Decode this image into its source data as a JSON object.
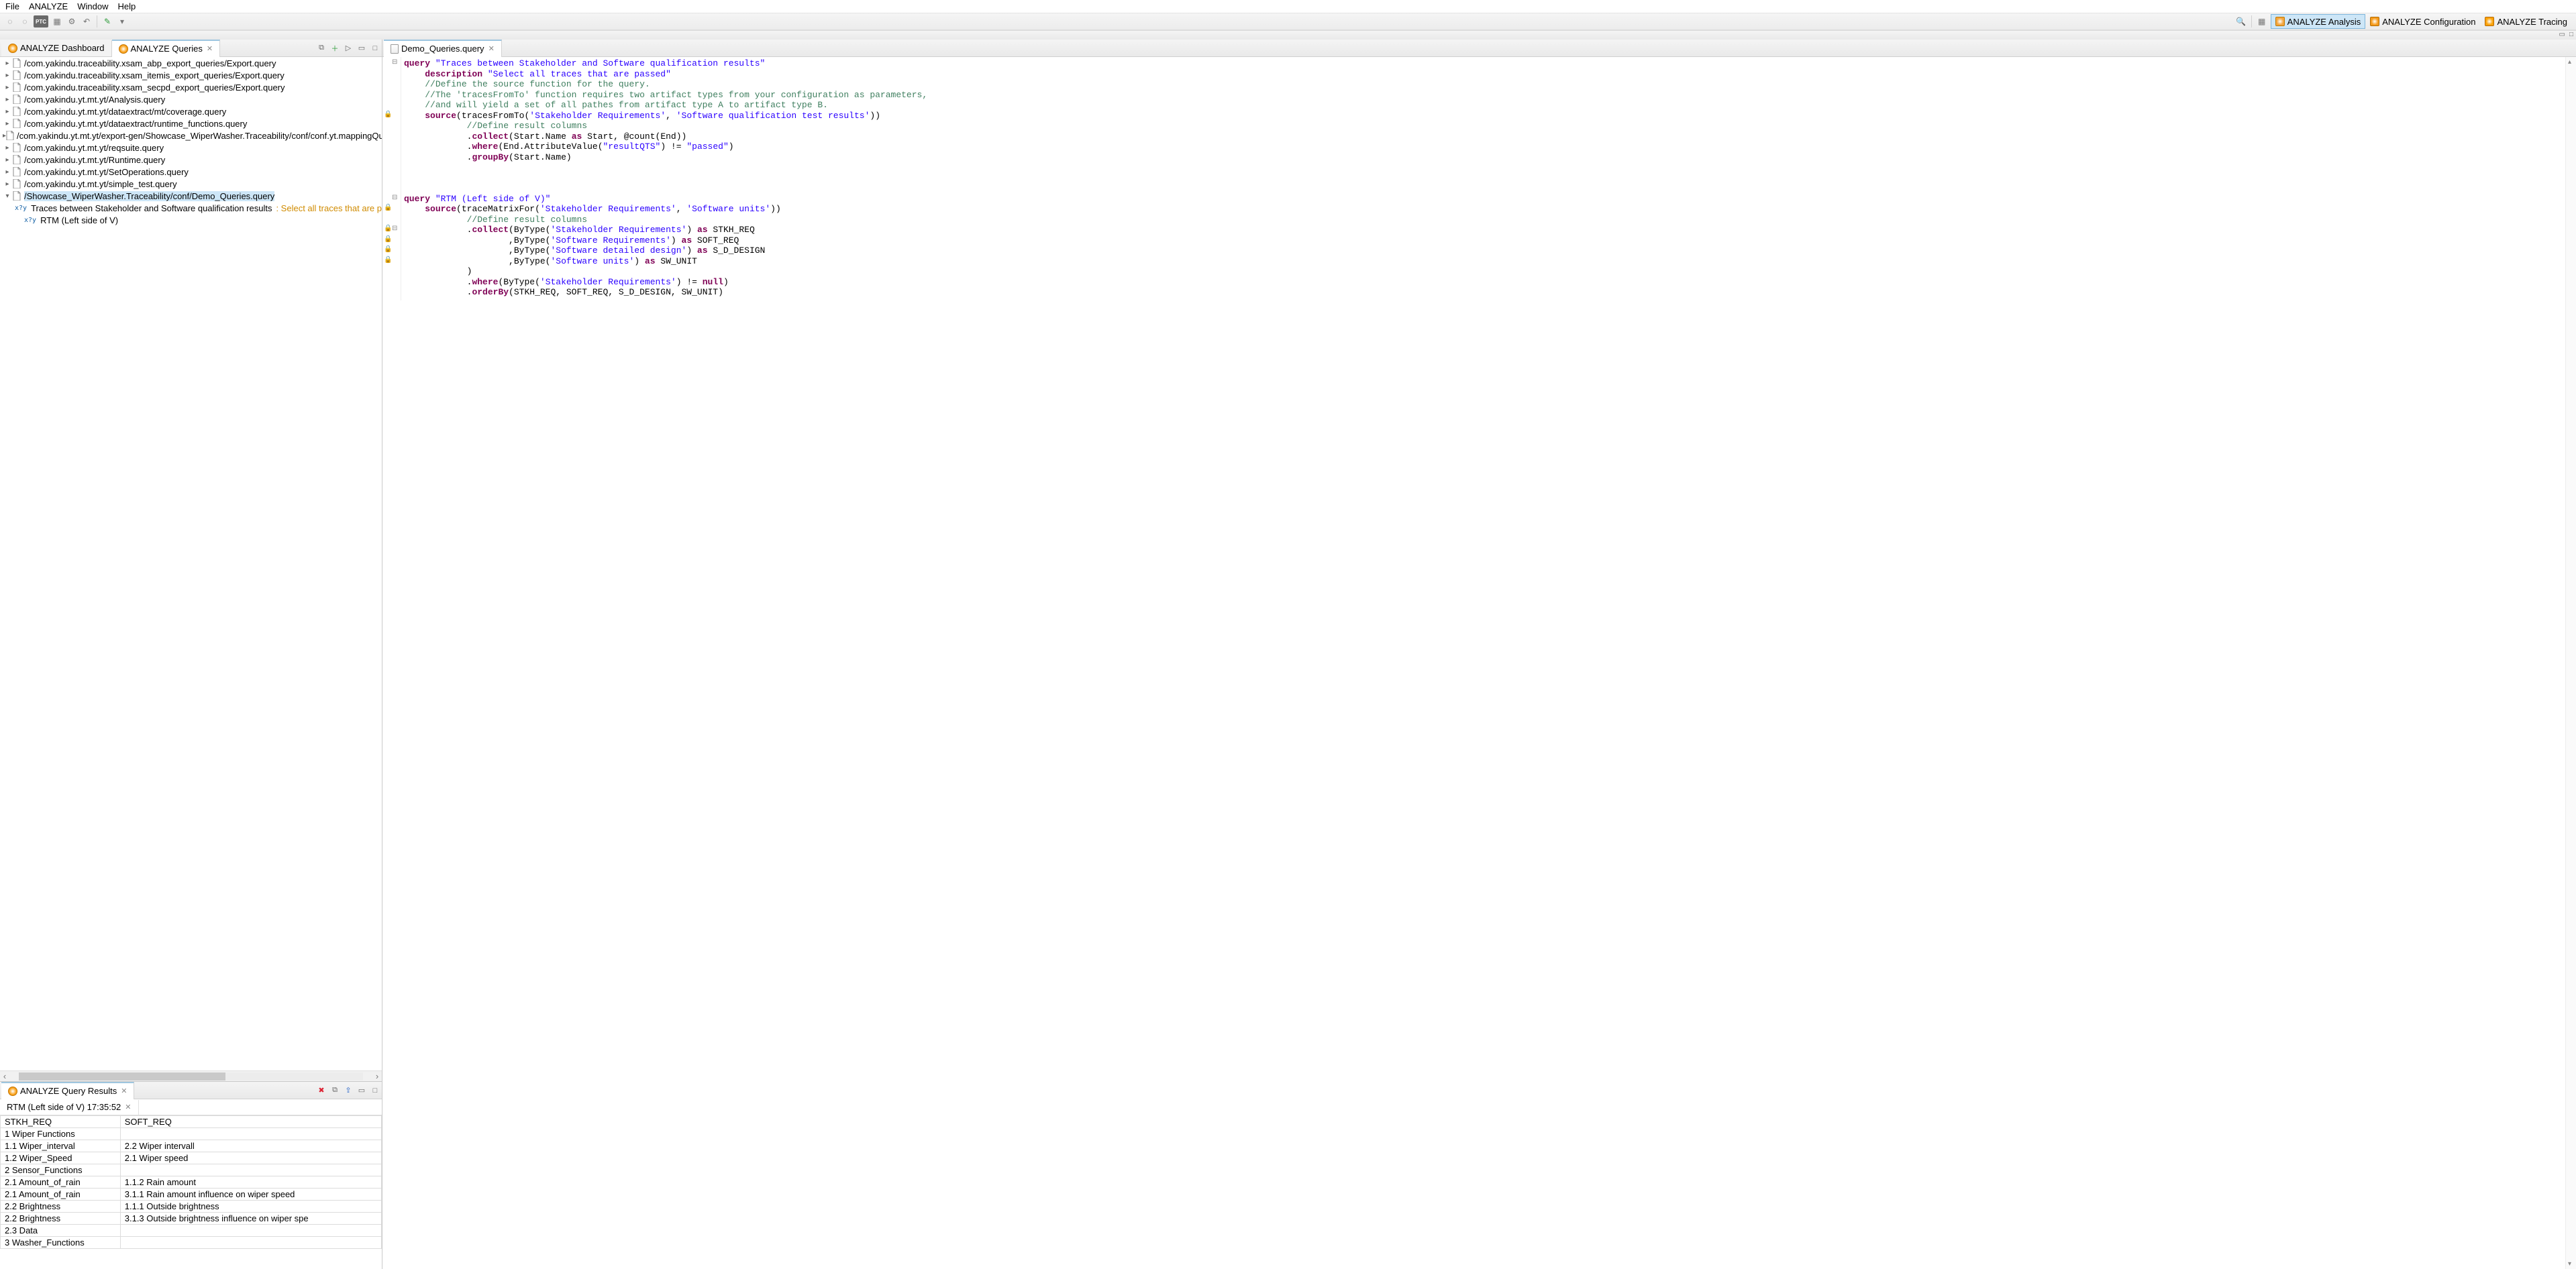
{
  "menu": {
    "items": [
      "File",
      "ANALYZE",
      "Window",
      "Help"
    ]
  },
  "toolbar_left_icons": [
    "nav-back-icon",
    "nav-fwd-icon",
    "ptc-icon",
    "grid-icon",
    "gear-icon",
    "undo-icon",
    "new-doc-icon",
    "dropdown-icon"
  ],
  "search_icon": "search",
  "open_persp_icon": "grid",
  "perspectives": [
    {
      "id": "analysis",
      "label": "ANALYZE Analysis",
      "active": true
    },
    {
      "id": "config",
      "label": "ANALYZE Configuration",
      "active": false
    },
    {
      "id": "tracing",
      "label": "ANALYZE Tracing",
      "active": false
    }
  ],
  "left_tabs": [
    {
      "id": "dashboard",
      "label": "ANALYZE Dashboard",
      "active": false,
      "closable": false
    },
    {
      "id": "queries",
      "label": "ANALYZE Queries",
      "active": true,
      "closable": true
    }
  ],
  "left_tab_toolbar": [
    "add-icon",
    "plus-icon",
    "run-icon",
    "minimize-icon",
    "maximize-icon"
  ],
  "tree": [
    {
      "expandable": true,
      "label": "/com.yakindu.traceability.xsam_abp_export_queries/Export.query"
    },
    {
      "expandable": true,
      "label": "/com.yakindu.traceability.xsam_itemis_export_queries/Export.query"
    },
    {
      "expandable": true,
      "label": "/com.yakindu.traceability.xsam_secpd_export_queries/Export.query"
    },
    {
      "expandable": true,
      "label": "/com.yakindu.yt.mt.yt/Analysis.query"
    },
    {
      "expandable": true,
      "label": "/com.yakindu.yt.mt.yt/dataextract/mt/coverage.query"
    },
    {
      "expandable": true,
      "label": "/com.yakindu.yt.mt.yt/dataextract/runtime_functions.query"
    },
    {
      "expandable": true,
      "label": "/com.yakindu.yt.mt.yt/export-gen/Showcase_WiperWasher.Traceability/conf/conf.yt.mappingQuerie"
    },
    {
      "expandable": true,
      "label": "/com.yakindu.yt.mt.yt/reqsuite.query"
    },
    {
      "expandable": true,
      "label": "/com.yakindu.yt.mt.yt/Runtime.query"
    },
    {
      "expandable": true,
      "label": "/com.yakindu.yt.mt.yt/SetOperations.query"
    },
    {
      "expandable": true,
      "label": "/com.yakindu.yt.mt.yt/simple_test.query"
    },
    {
      "expandable": true,
      "open": true,
      "selected": true,
      "label": "/Showcase_WiperWasher.Traceability/conf/Demo_Queries.query",
      "children": [
        {
          "q": true,
          "label": "Traces between Stakeholder and Software qualification results",
          "suffix": ": Select all traces that are passed"
        },
        {
          "q": true,
          "label": "RTM (Left side of V)"
        }
      ]
    }
  ],
  "results_view": {
    "title": "ANALYZE Query Results",
    "toolbar": [
      "delete-icon",
      "copy-icon",
      "export-icon",
      "minimize-icon",
      "maximize-icon"
    ],
    "inner_tab": "RTM (Left side of V) 17:35:52",
    "columns": [
      "STKH_REQ",
      "SOFT_REQ"
    ],
    "rows": [
      [
        "1 Wiper Functions",
        ""
      ],
      [
        "1.1 Wiper_interval",
        "2.2 Wiper intervall"
      ],
      [
        "1.2 Wiper_Speed",
        "2.1 Wiper speed"
      ],
      [
        "2 Sensor_Functions",
        ""
      ],
      [
        "2.1 Amount_of_rain",
        "1.1.2 Rain amount"
      ],
      [
        "2.1 Amount_of_rain",
        "3.1.1 Rain amount influence on wiper speed"
      ],
      [
        "2.2 Brightness",
        "1.1.1 Outside brightness"
      ],
      [
        "2.2 Brightness",
        "3.1.3 Outside brightness influence on wiper spe"
      ],
      [
        "2.3 Data",
        ""
      ],
      [
        "3 Washer_Functions",
        ""
      ]
    ]
  },
  "editor_tab": "Demo_Queries.query",
  "code_lines": [
    {
      "fold": "-",
      "tokens": [
        {
          "t": "kw",
          "v": "query"
        },
        {
          "t": "sp"
        },
        {
          "t": "str",
          "v": "\"Traces between Stakeholder and Software qualification results\""
        }
      ]
    },
    {
      "tokens": [
        {
          "t": "in",
          "n": 1
        },
        {
          "t": "kw",
          "v": "description"
        },
        {
          "t": "sp"
        },
        {
          "t": "str",
          "v": "\"Select all traces that are passed\""
        }
      ]
    },
    {
      "tokens": [
        {
          "t": "in",
          "n": 1
        },
        {
          "t": "cm",
          "v": "//Define the source function for the query."
        }
      ]
    },
    {
      "tokens": [
        {
          "t": "in",
          "n": 1
        },
        {
          "t": "cm",
          "v": "//The 'tracesFromTo' function requires two artifact types from your configuration as parameters,"
        }
      ]
    },
    {
      "tokens": [
        {
          "t": "in",
          "n": 1
        },
        {
          "t": "cm",
          "v": "//and will yield a set of all pathes from artifact type A to artifact type B."
        }
      ]
    },
    {
      "lock": true,
      "tokens": [
        {
          "t": "in",
          "n": 1
        },
        {
          "t": "kw",
          "v": "source"
        },
        {
          "t": "op",
          "v": "("
        },
        {
          "t": "id",
          "v": "tracesFromTo"
        },
        {
          "t": "op",
          "v": "("
        },
        {
          "t": "str",
          "v": "'Stakeholder Requirements'"
        },
        {
          "t": "op",
          "v": ", "
        },
        {
          "t": "str",
          "v": "'Software qualification test results'"
        },
        {
          "t": "op",
          "v": "))"
        }
      ]
    },
    {
      "tokens": [
        {
          "t": "in",
          "n": 3
        },
        {
          "t": "cm",
          "v": "//Define result columns"
        }
      ]
    },
    {
      "tokens": [
        {
          "t": "in",
          "n": 3
        },
        {
          "t": "op",
          "v": "."
        },
        {
          "t": "kw",
          "v": "collect"
        },
        {
          "t": "op",
          "v": "("
        },
        {
          "t": "id",
          "v": "Start.Name "
        },
        {
          "t": "kw",
          "v": "as"
        },
        {
          "t": "id",
          "v": " Start, @count(End)"
        },
        {
          "t": "op",
          "v": ")"
        }
      ]
    },
    {
      "tokens": [
        {
          "t": "in",
          "n": 3
        },
        {
          "t": "op",
          "v": "."
        },
        {
          "t": "kw",
          "v": "where"
        },
        {
          "t": "op",
          "v": "("
        },
        {
          "t": "id",
          "v": "End.AttributeValue("
        },
        {
          "t": "str",
          "v": "\"resultQTS\""
        },
        {
          "t": "id",
          "v": ") != "
        },
        {
          "t": "str",
          "v": "\"passed\""
        },
        {
          "t": "op",
          "v": ")"
        }
      ]
    },
    {
      "tokens": [
        {
          "t": "in",
          "n": 3
        },
        {
          "t": "op",
          "v": "."
        },
        {
          "t": "kw",
          "v": "groupBy"
        },
        {
          "t": "op",
          "v": "("
        },
        {
          "t": "id",
          "v": "Start.Name"
        },
        {
          "t": "op",
          "v": ")"
        }
      ]
    },
    {
      "blank": true
    },
    {
      "blank": true
    },
    {
      "blank": true
    },
    {
      "fold": "-",
      "tokens": [
        {
          "t": "kw",
          "v": "query"
        },
        {
          "t": "sp"
        },
        {
          "t": "str",
          "v": "\"RTM (Left side of V)\""
        }
      ]
    },
    {
      "lock": true,
      "tokens": [
        {
          "t": "in",
          "n": 1
        },
        {
          "t": "kw",
          "v": "source"
        },
        {
          "t": "op",
          "v": "("
        },
        {
          "t": "id",
          "v": "traceMatrixFor"
        },
        {
          "t": "op",
          "v": "("
        },
        {
          "t": "str",
          "v": "'Stakeholder Requirements'"
        },
        {
          "t": "op",
          "v": ", "
        },
        {
          "t": "str",
          "v": "'Software units'"
        },
        {
          "t": "op",
          "v": "))"
        }
      ]
    },
    {
      "tokens": [
        {
          "t": "in",
          "n": 3
        },
        {
          "t": "cm",
          "v": "//Define result columns"
        }
      ]
    },
    {
      "lock": true,
      "fold": "-",
      "tokens": [
        {
          "t": "in",
          "n": 3
        },
        {
          "t": "op",
          "v": "."
        },
        {
          "t": "kw",
          "v": "collect"
        },
        {
          "t": "op",
          "v": "("
        },
        {
          "t": "id",
          "v": "ByType"
        },
        {
          "t": "op",
          "v": "("
        },
        {
          "t": "str",
          "v": "'Stakeholder Requirements'"
        },
        {
          "t": "op",
          "v": ") "
        },
        {
          "t": "kw",
          "v": "as"
        },
        {
          "t": "id",
          "v": " STKH_REQ"
        }
      ]
    },
    {
      "lock": true,
      "tokens": [
        {
          "t": "in",
          "n": 5
        },
        {
          "t": "op",
          "v": ","
        },
        {
          "t": "id",
          "v": "ByType"
        },
        {
          "t": "op",
          "v": "("
        },
        {
          "t": "str",
          "v": "'Software Requirements'"
        },
        {
          "t": "op",
          "v": ") "
        },
        {
          "t": "kw",
          "v": "as"
        },
        {
          "t": "id",
          "v": " SOFT_REQ"
        }
      ]
    },
    {
      "lock": true,
      "tokens": [
        {
          "t": "in",
          "n": 5
        },
        {
          "t": "op",
          "v": ","
        },
        {
          "t": "id",
          "v": "ByType"
        },
        {
          "t": "op",
          "v": "("
        },
        {
          "t": "str",
          "v": "'Software detailed design'"
        },
        {
          "t": "op",
          "v": ") "
        },
        {
          "t": "kw",
          "v": "as"
        },
        {
          "t": "id",
          "v": " S_D_DESIGN"
        }
      ]
    },
    {
      "lock": true,
      "tokens": [
        {
          "t": "in",
          "n": 5
        },
        {
          "t": "op",
          "v": ","
        },
        {
          "t": "id",
          "v": "ByType"
        },
        {
          "t": "op",
          "v": "("
        },
        {
          "t": "str",
          "v": "'Software units'"
        },
        {
          "t": "op",
          "v": ") "
        },
        {
          "t": "kw",
          "v": "as"
        },
        {
          "t": "id",
          "v": " SW_UNIT"
        }
      ]
    },
    {
      "tokens": [
        {
          "t": "in",
          "n": 3
        },
        {
          "t": "op",
          "v": ")"
        }
      ]
    },
    {
      "tokens": [
        {
          "t": "in",
          "n": 3
        },
        {
          "t": "op",
          "v": "."
        },
        {
          "t": "kw",
          "v": "where"
        },
        {
          "t": "op",
          "v": "("
        },
        {
          "t": "id",
          "v": "ByType"
        },
        {
          "t": "op",
          "v": "("
        },
        {
          "t": "str",
          "v": "'Stakeholder Requirements'"
        },
        {
          "t": "op",
          "v": ") != "
        },
        {
          "t": "kw",
          "v": "null"
        },
        {
          "t": "op",
          "v": ")"
        }
      ]
    },
    {
      "hl": true,
      "tokens": [
        {
          "t": "in",
          "n": 3
        },
        {
          "t": "op",
          "v": "."
        },
        {
          "t": "kw",
          "v": "orderBy"
        },
        {
          "t": "op",
          "v": "("
        },
        {
          "t": "id",
          "v": "STKH_REQ, SOFT_REQ, S_D_DESIGN, SW_UNIT"
        },
        {
          "t": "op",
          "v": ")"
        }
      ]
    }
  ]
}
